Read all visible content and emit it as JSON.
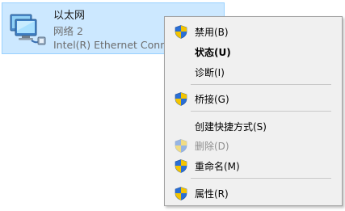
{
  "adapter": {
    "name": "以太网",
    "network": "网络 2",
    "device": "Intel(R) Ethernet Connection",
    "icon": "network-adapter-icon"
  },
  "menu": {
    "items": [
      {
        "label": "禁用(B)",
        "icon": "shield-icon",
        "bold": false,
        "disabled": false
      },
      {
        "label": "状态(U)",
        "icon": null,
        "bold": true,
        "disabled": false
      },
      {
        "label": "诊断(I)",
        "icon": null,
        "bold": false,
        "disabled": false
      },
      {
        "label": "桥接(G)",
        "icon": "shield-icon",
        "bold": false,
        "disabled": false
      },
      {
        "label": "创建快捷方式(S)",
        "icon": null,
        "bold": false,
        "disabled": false
      },
      {
        "label": "删除(D)",
        "icon": "shield-icon",
        "bold": false,
        "disabled": true
      },
      {
        "label": "重命名(M)",
        "icon": "shield-icon",
        "bold": false,
        "disabled": false
      },
      {
        "label": "属性(R)",
        "icon": "shield-icon",
        "bold": false,
        "disabled": false
      }
    ]
  },
  "colors": {
    "selection_bg": "#cce8ff",
    "selection_border": "#99d1ff",
    "menu_bg": "#f0f0f0",
    "shield_blue": "#2a6fd6",
    "shield_yellow": "#f4c400"
  }
}
